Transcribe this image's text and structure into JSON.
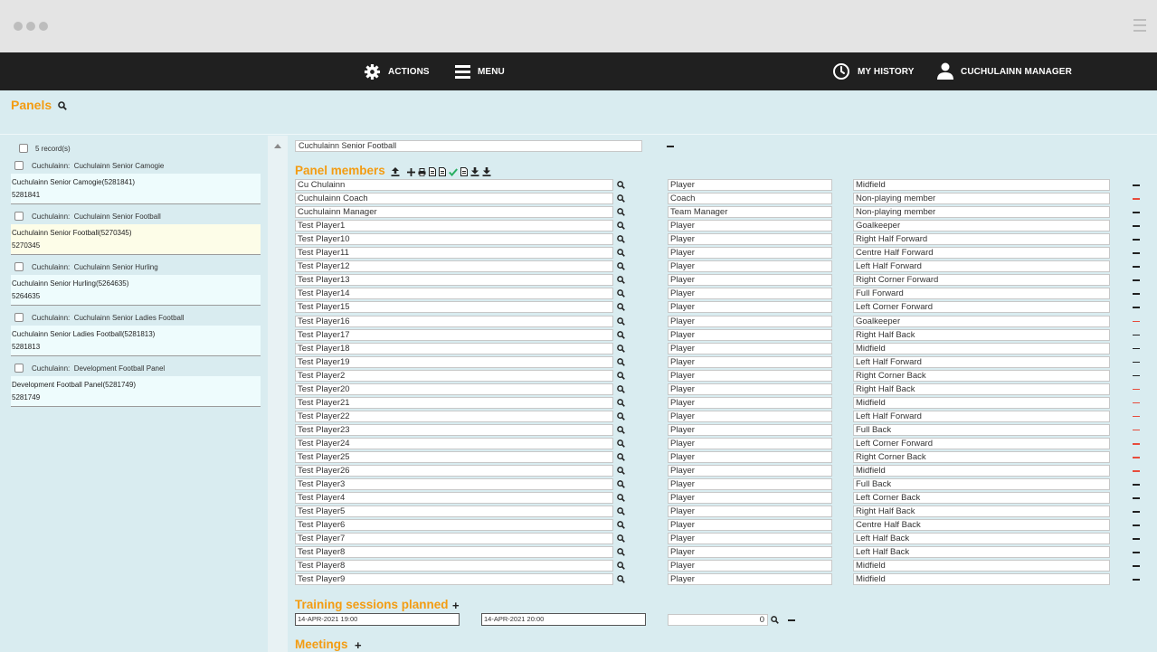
{
  "nav": {
    "actions_label": "ACTIONS",
    "menu_label": "MENU",
    "history_label": "MY HISTORY",
    "user_label": "CUCHULAINN MANAGER"
  },
  "panels_title": "Panels",
  "record_count": "5 record(s)",
  "records": [
    {
      "club": "Cuchulainn:",
      "name": "Cuchulainn Senior Camogie",
      "line": "Cuchulainn Senior Camogie(5281841)",
      "id": "5281841"
    },
    {
      "club": "Cuchulainn:",
      "name": "Cuchulainn Senior Football",
      "line": "Cuchulainn Senior Football(5270345)",
      "id": "5270345"
    },
    {
      "club": "Cuchulainn:",
      "name": "Cuchulainn Senior Hurling",
      "line": "Cuchulainn Senior Hurling(5264635)",
      "id": "5264635"
    },
    {
      "club": "Cuchulainn:",
      "name": "Cuchulainn Senior Ladies Football",
      "line": "Cuchulainn Senior Ladies Football(5281813)",
      "id": "5281813"
    },
    {
      "club": "Cuchulainn:",
      "name": "Development Football Panel",
      "line": "Development Football Panel(5281749)",
      "id": "5281749"
    }
  ],
  "selected_panel": "Cuchulainn Senior Football",
  "panel_members_title": "Panel members",
  "members": [
    {
      "name": "Cu Chulainn",
      "role": "Player",
      "position": "Midfield",
      "red": false
    },
    {
      "name": "Cuchulainn Coach",
      "role": "Coach",
      "position": "Non-playing member",
      "red": true
    },
    {
      "name": "Cuchulainn Manager",
      "role": "Team Manager",
      "position": "Non-playing member",
      "red": false
    },
    {
      "name": "Test Player1",
      "role": "Player",
      "position": "Goalkeeper",
      "red": false
    },
    {
      "name": "Test Player10",
      "role": "Player",
      "position": "Right Half Forward",
      "red": false
    },
    {
      "name": "Test Player11",
      "role": "Player",
      "position": "Centre Half Forward",
      "red": false
    },
    {
      "name": "Test Player12",
      "role": "Player",
      "position": "Left Half Forward",
      "red": false
    },
    {
      "name": "Test Player13",
      "role": "Player",
      "position": "Right Corner Forward",
      "red": false
    },
    {
      "name": "Test Player14",
      "role": "Player",
      "position": "Full Forward",
      "red": false
    },
    {
      "name": "Test Player15",
      "role": "Player",
      "position": "Left Corner Forward",
      "red": false
    },
    {
      "name": "Test Player16",
      "role": "Player",
      "position": "Goalkeeper",
      "red": true
    },
    {
      "name": "Test Player17",
      "role": "Player",
      "position": "Right Half Back",
      "red": false
    },
    {
      "name": "Test Player18",
      "role": "Player",
      "position": "Midfield",
      "red": false
    },
    {
      "name": "Test Player19",
      "role": "Player",
      "position": "Left Half Forward",
      "red": false
    },
    {
      "name": "Test Player2",
      "role": "Player",
      "position": "Right Corner Back",
      "red": false
    },
    {
      "name": "Test Player20",
      "role": "Player",
      "position": "Right Half Back",
      "red": true
    },
    {
      "name": "Test Player21",
      "role": "Player",
      "position": "Midfield",
      "red": true
    },
    {
      "name": "Test Player22",
      "role": "Player",
      "position": "Left Half Forward",
      "red": true
    },
    {
      "name": "Test Player23",
      "role": "Player",
      "position": "Full Back",
      "red": true
    },
    {
      "name": "Test Player24",
      "role": "Player",
      "position": "Left Corner Forward",
      "red": true
    },
    {
      "name": "Test Player25",
      "role": "Player",
      "position": "Right Corner Back",
      "red": true
    },
    {
      "name": "Test Player26",
      "role": "Player",
      "position": "Midfield",
      "red": true
    },
    {
      "name": "Test Player3",
      "role": "Player",
      "position": "Full Back",
      "red": false
    },
    {
      "name": "Test Player4",
      "role": "Player",
      "position": "Left Corner Back",
      "red": false
    },
    {
      "name": "Test Player5",
      "role": "Player",
      "position": "Right Half Back",
      "red": false
    },
    {
      "name": "Test Player6",
      "role": "Player",
      "position": "Centre Half Back",
      "red": false
    },
    {
      "name": "Test Player7",
      "role": "Player",
      "position": "Left Half Back",
      "red": false
    },
    {
      "name": "Test Player8",
      "role": "Player",
      "position": "Left Half Back",
      "red": false
    },
    {
      "name": "Test Player8",
      "role": "Player",
      "position": "Midfield",
      "red": false
    },
    {
      "name": "Test Player9",
      "role": "Player",
      "position": "Midfield",
      "red": false
    }
  ],
  "training": {
    "title": "Training sessions planned",
    "start": "14-APR-2021 19:00",
    "end": "14-APR-2021 20:00",
    "count": "0"
  },
  "meetings_title": "Meetings",
  "colors": {
    "accent": "#f39c12",
    "nav_bg": "#202020",
    "app_bg": "#d9ecf0",
    "remove_red": "#e74c3c"
  }
}
